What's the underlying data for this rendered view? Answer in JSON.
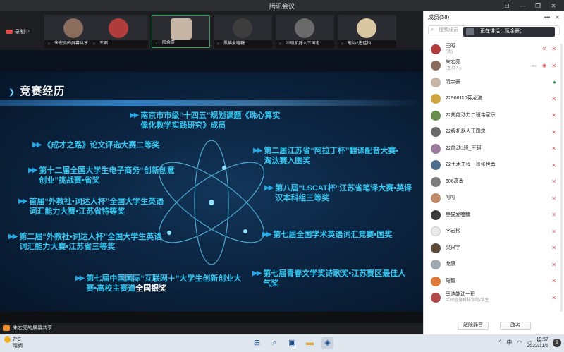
{
  "app": {
    "title": "腾讯会议"
  },
  "window_controls": [
    "⊟",
    "—",
    "❐",
    "✕"
  ],
  "recording": {
    "label": "录制中"
  },
  "participants_strip": [
    {
      "name": "朱宏亮的屏幕共享",
      "color": "#8a6d5c",
      "speaking": false,
      "mic": "off"
    },
    {
      "name": "王昭",
      "color": "#b23b3b",
      "speaking": false,
      "mic": "off"
    },
    {
      "name": "阮余豪",
      "color": "#c7b6a6",
      "speaking": true,
      "mic": "on"
    },
    {
      "name": "黑猫爱嗑糖",
      "color": "#3c3c3c",
      "speaking": false,
      "mic": "off"
    },
    {
      "name": "22级机器人王国忠",
      "color": "#6a6a6a",
      "speaking": false,
      "mic": "off"
    },
    {
      "name": "能动2庄佳怡",
      "color": "#d8c7a0",
      "speaking": false,
      "mic": "off"
    }
  ],
  "slide": {
    "heading": "竞赛经历",
    "items": [
      {
        "text": "南京市市级“十四五”规划课题《珠心算实像化教学实践研究》成员",
        "bold_tail": ""
      },
      {
        "text": "《成才之路》论文评选大赛二等奖",
        "bold_tail": ""
      },
      {
        "text": "第十二届全国大学生电子商务“创新创意 创业”挑战赛•省奖",
        "bold_tail": ""
      },
      {
        "text": "首届“外教社•词达人杯”全国大学生英语词汇能力大赛•江苏省特等奖",
        "bold_tail": ""
      },
      {
        "text": "第二届“外教社•词达人杯”全国大学生英语词汇能力大赛•江苏省三等奖",
        "bold_tail": ""
      },
      {
        "text": "第七届中国国际“互联网＋”大学生创新创业大赛•高校主赛道",
        "bold_tail": "全国银奖"
      },
      {
        "text": "第二届江苏省“阿拉丁杯”翻译配音大赛•淘汰赛入围奖",
        "bold_tail": ""
      },
      {
        "text": "第八届“LSCAT杯”江苏省笔译大赛•英译汉本科组三等奖",
        "bold_tail": ""
      },
      {
        "text": "第七届全国学术英语词汇竞赛•国奖",
        "bold_tail": ""
      },
      {
        "text": "第七届青春文学奖诗歌奖•江苏赛区最佳人气奖",
        "bold_tail": ""
      }
    ]
  },
  "sharebar": {
    "label": "朱宏亮的屏幕共享"
  },
  "panel": {
    "title": "成员(38)",
    "search_placeholder": "搜索成员",
    "speaking_toast": "正在讲话：阮余豪；",
    "members": [
      {
        "name": "王昭",
        "sub": "(我)",
        "color": "#b23b3b",
        "mic": "off"
      },
      {
        "name": "朱宏亮",
        "sub": "(主持人)",
        "color": "#8a6d5c",
        "mic": "off"
      },
      {
        "name": "阮余豪",
        "sub": "",
        "color": "#c7b6a6",
        "mic": "on"
      },
      {
        "name": "22900110蒋龙波",
        "sub": "",
        "color": "#d0a640",
        "mic": "off"
      },
      {
        "name": "22热能动力二班韦家乐",
        "sub": "",
        "color": "#6b8e4e",
        "mic": "off"
      },
      {
        "name": "22级机器人王国忠",
        "sub": "",
        "color": "#6a6a6a",
        "mic": "off"
      },
      {
        "name": "22能动1班_王珂",
        "sub": "",
        "color": "#9b7a9e",
        "mic": "off"
      },
      {
        "name": "22土木工程一班张世勇",
        "sub": "",
        "color": "#4e6e8e",
        "mic": "off"
      },
      {
        "name": "606高勇",
        "sub": "",
        "color": "#7d7d7d",
        "mic": "off"
      },
      {
        "name": "叮叮",
        "sub": "",
        "color": "#c08c6a",
        "mic": "off"
      },
      {
        "name": "黑猫爱嗑糖",
        "sub": "",
        "color": "#3c3c3c",
        "mic": "off"
      },
      {
        "name": "李岩松",
        "sub": "",
        "color": "#e8e8e8",
        "mic": "off"
      },
      {
        "name": "梁兴宇",
        "sub": "",
        "color": "#5f4b3a",
        "mic": "off"
      },
      {
        "name": "龙康",
        "sub": "",
        "color": "#a0a8b0",
        "mic": "off"
      },
      {
        "name": "马毅",
        "sub": "",
        "color": "#e07a3a",
        "mic": "off"
      },
      {
        "name": "马浩能动一班",
        "sub": "兰州信息科技学院/学生",
        "color": "#b04a4a",
        "mic": "off"
      }
    ],
    "footer": {
      "mute_all": "解除静音",
      "rename": "改名"
    }
  },
  "taskbar": {
    "weather_temp": "7°C",
    "weather_desc": "晴朗",
    "icons": [
      "windows-start",
      "search",
      "task-view",
      "file-explorer",
      "tencent-meeting"
    ],
    "tray": [
      "^",
      "中",
      "wifi",
      "speaker",
      "battery"
    ],
    "time": "19:57",
    "date": "2022/11/5",
    "notif_count": "1"
  }
}
